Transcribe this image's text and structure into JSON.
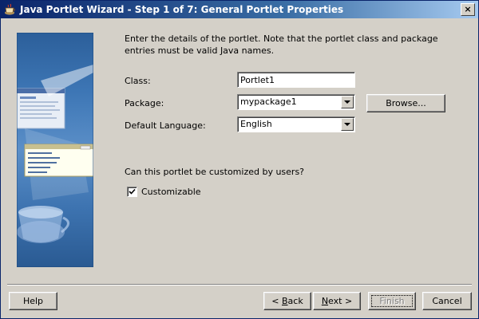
{
  "window": {
    "title": "Java Portlet Wizard - Step 1 of 7: General Portlet Properties",
    "close_label": "×"
  },
  "main": {
    "prompt": "Enter the details of the portlet. Note that the portlet class and package entries must be valid Java names.",
    "class_label": "Class:",
    "class_value": "Portlet1",
    "package_label": "Package:",
    "package_value": "mypackage1",
    "browse_label": "Browse...",
    "language_label": "Default Language:",
    "language_value": "English",
    "customize_question": "Can this portlet be customized by users?",
    "customizable_label": "Customizable",
    "customizable_checked": true
  },
  "footer": {
    "help_label": "Help",
    "back_prefix": "< ",
    "back_accel": "B",
    "back_rest": "ack",
    "next_accel": "N",
    "next_rest": "ext >",
    "finish_label": "Finish",
    "cancel_label": "Cancel"
  },
  "colors": {
    "titlebar_start": "#0a246a",
    "titlebar_end": "#a6caf0",
    "dialog_bg": "#d4d0c8",
    "image_blue": "#3d76b5"
  }
}
